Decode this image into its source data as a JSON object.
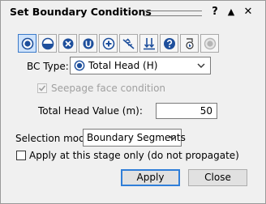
{
  "dialog": {
    "title": "Set Boundary Conditions",
    "help_label": "?",
    "collapse_label": "▲",
    "close_label": "✕"
  },
  "toolbar": {
    "buttons": [
      {
        "icon": "total-head-boundary-icon",
        "selected": true
      },
      {
        "icon": "pressure-head-boundary-icon"
      },
      {
        "icon": "unit-flow-boundary-icon"
      },
      {
        "icon": "unknown-boundary-icon"
      },
      {
        "icon": "add-flow-icon"
      },
      {
        "icon": "seepage-boundary-icon"
      },
      {
        "icon": "infiltration-boundary-icon"
      },
      {
        "icon": "help-icon"
      },
      {
        "icon": "pick-boundary-icon"
      },
      {
        "icon": "disabled-record-icon",
        "disabled": true
      }
    ]
  },
  "form": {
    "bc_type_label": "BC Type:",
    "bc_type_value": "Total Head (H)",
    "seepage_label": "Seepage face condition",
    "total_head_label": "Total Head Value (m):",
    "total_head_value": "50",
    "selection_mode_label": "Selection mode:",
    "selection_mode_value": "Boundary Segments",
    "apply_stage_label": "Apply at this stage only (do not propagate)"
  },
  "buttons": {
    "apply_label": "Apply",
    "close_label": "Close"
  },
  "colors": {
    "accent": "#2f7ed8",
    "selected_bg": "#cfe3fb",
    "disabled_text": "#a0a0a0"
  }
}
